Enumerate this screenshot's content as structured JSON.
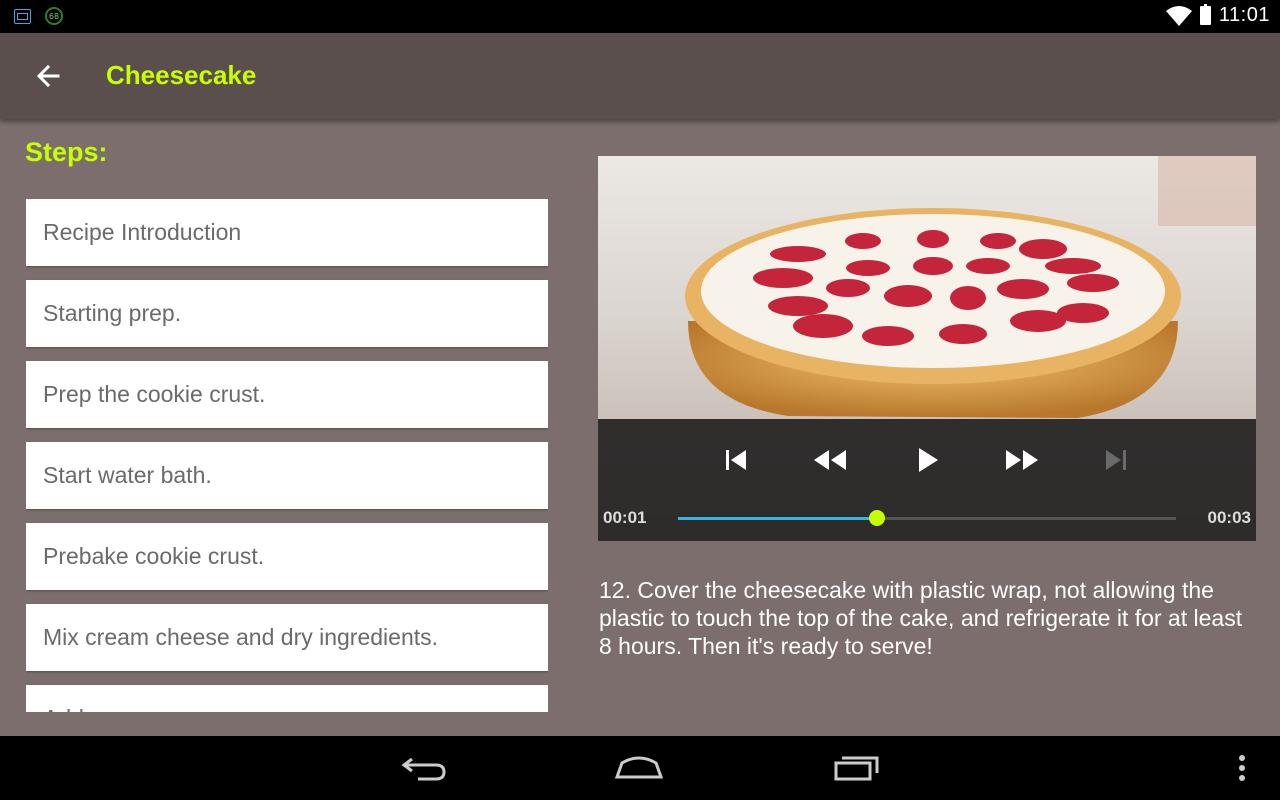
{
  "status_bar": {
    "notification_badge": "68",
    "time": "11:01"
  },
  "app_bar": {
    "title": "Cheesecake",
    "title_color": "#c6ff00"
  },
  "steps": {
    "heading": "Steps:",
    "items": [
      {
        "label": "Recipe Introduction"
      },
      {
        "label": "Starting prep."
      },
      {
        "label": "Prep the cookie crust."
      },
      {
        "label": "Start water bath."
      },
      {
        "label": "Prebake cookie crust."
      },
      {
        "label": "Mix cream cheese and dry ingredients."
      },
      {
        "label": "Add..."
      }
    ]
  },
  "player": {
    "elapsed": "00:01",
    "duration": "00:03",
    "progress": 0.4,
    "accent_color": "#c6ff00",
    "track_color": "#33b5e5"
  },
  "description": {
    "text": "12. Cover the cheesecake with plastic wrap, not allowing the plastic to touch the top of the cake, and refrigerate it for at least 8 hours. Then it's ready to serve!"
  }
}
